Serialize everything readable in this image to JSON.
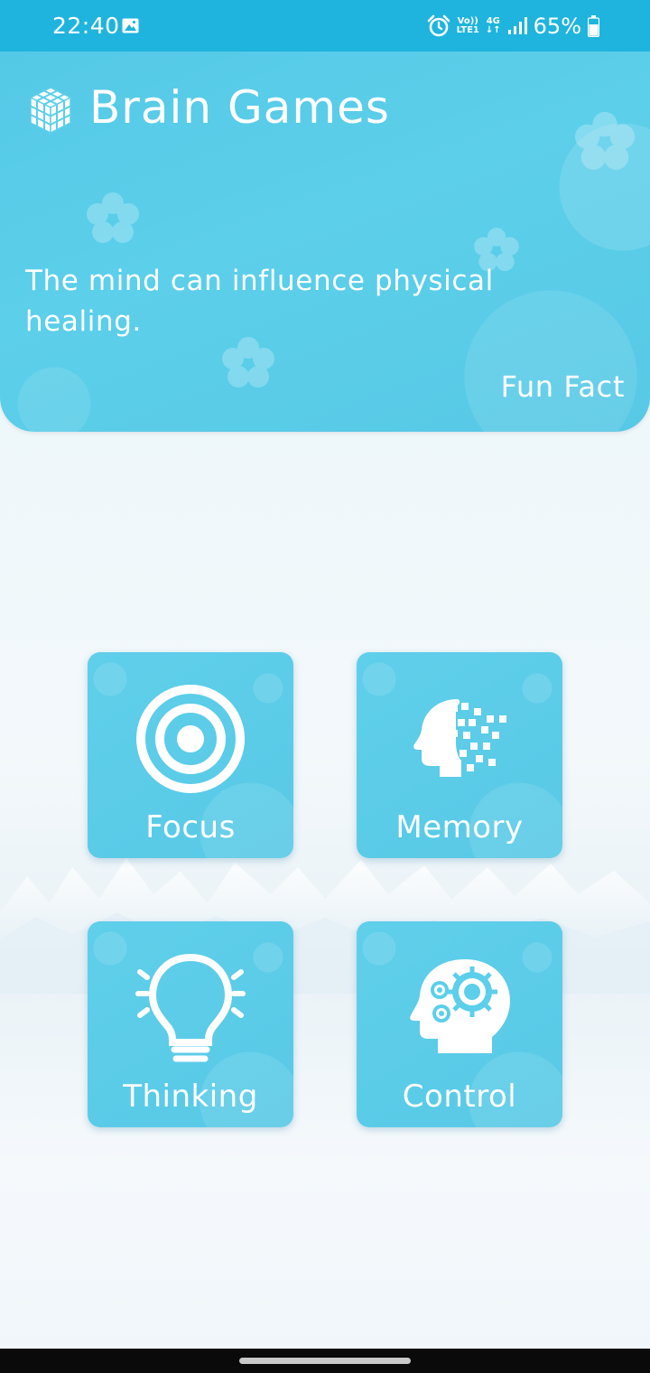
{
  "status_bar": {
    "time": "22:40",
    "network_top": "Vo))",
    "network_bottom": "LTE1",
    "generation_top": "4G",
    "generation_bottom": "↓↑",
    "battery": "65%",
    "icons": [
      "gallery-icon",
      "alarm-icon",
      "signal-icon",
      "battery-icon"
    ]
  },
  "header": {
    "app_title": "Brain Games",
    "fact_text": "The mind can influence physical healing.",
    "fact_label": "Fun Fact",
    "logo_icon": "cube-icon"
  },
  "tiles": [
    {
      "label": "Focus",
      "icon": "target-icon"
    },
    {
      "label": "Memory",
      "icon": "head-pixels-icon"
    },
    {
      "label": "Thinking",
      "icon": "lightbulb-icon"
    },
    {
      "label": "Control",
      "icon": "head-gears-icon"
    }
  ],
  "colors": {
    "status_bar": "#1fb4dd",
    "card": "#58c9e6",
    "text": "#ffffff"
  }
}
